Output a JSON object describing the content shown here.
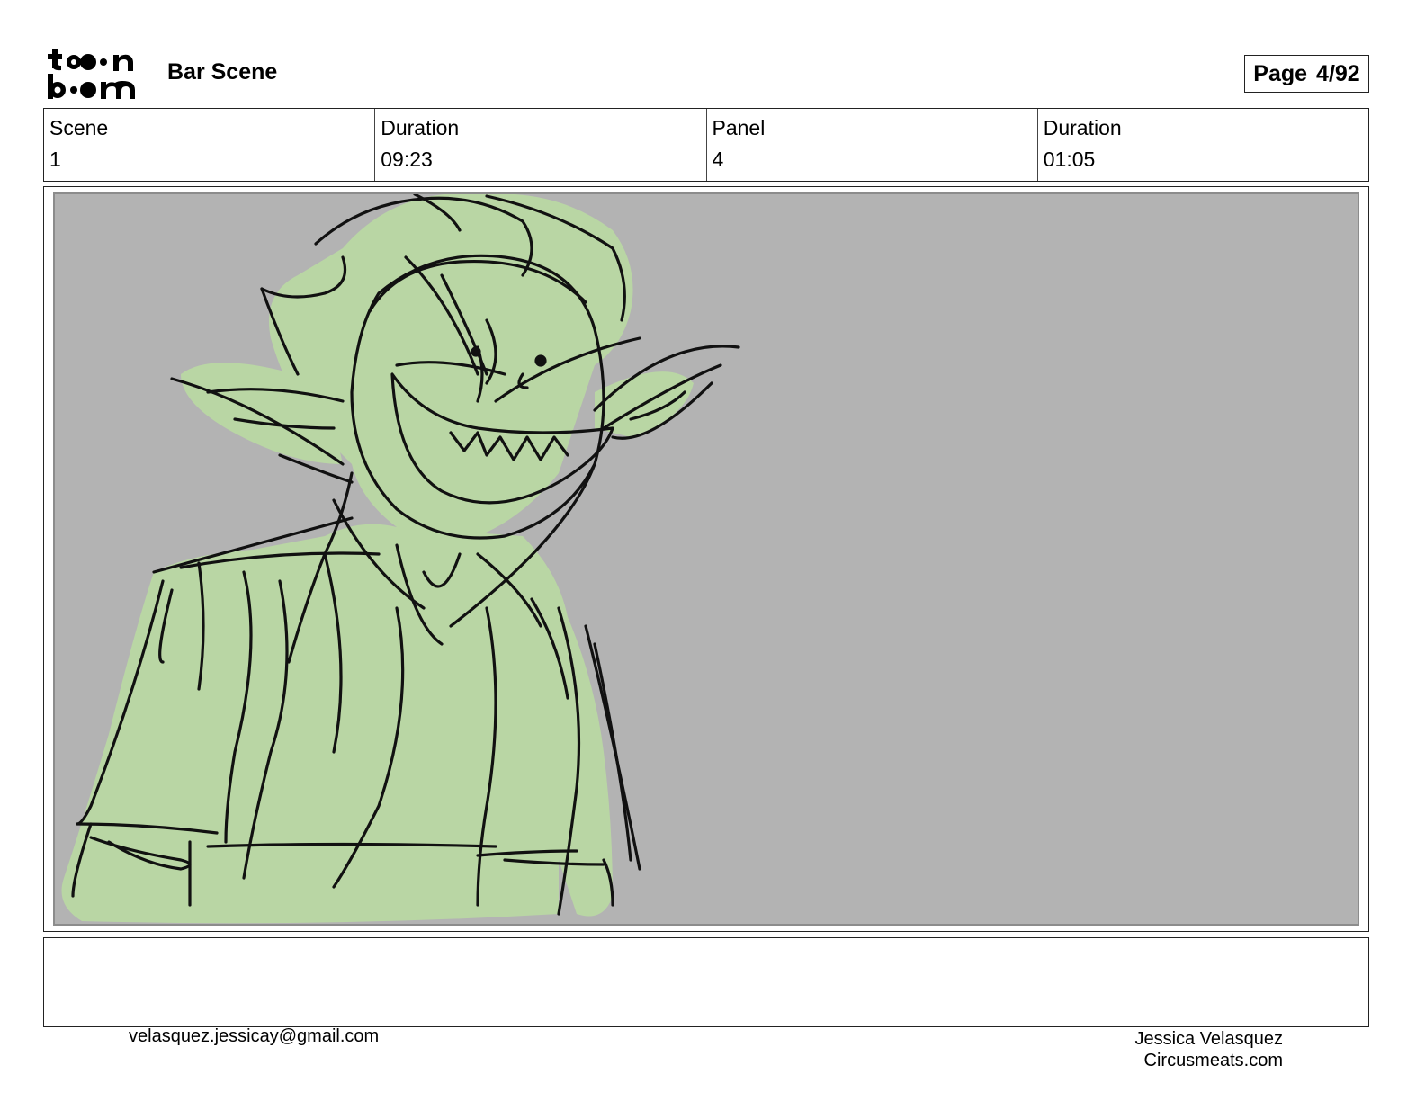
{
  "header": {
    "logo_alt": "toonboom",
    "title": "Bar Scene",
    "page_label": "Page",
    "page_value": "4/92"
  },
  "info": [
    {
      "label": "Scene",
      "value": "1"
    },
    {
      "label": "Duration",
      "value": "09:23"
    },
    {
      "label": "Panel",
      "value": "4"
    },
    {
      "label": "Duration",
      "value": "01:05"
    }
  ],
  "panel": {
    "background_color": "#b3b3b3",
    "fill_color": "#b9d6a4",
    "line_color": "#111111"
  },
  "notes": "",
  "footer": {
    "email": "velasquez.jessicay@gmail.com",
    "author": "Jessica Velasquez",
    "website": "Circusmeats.com"
  }
}
